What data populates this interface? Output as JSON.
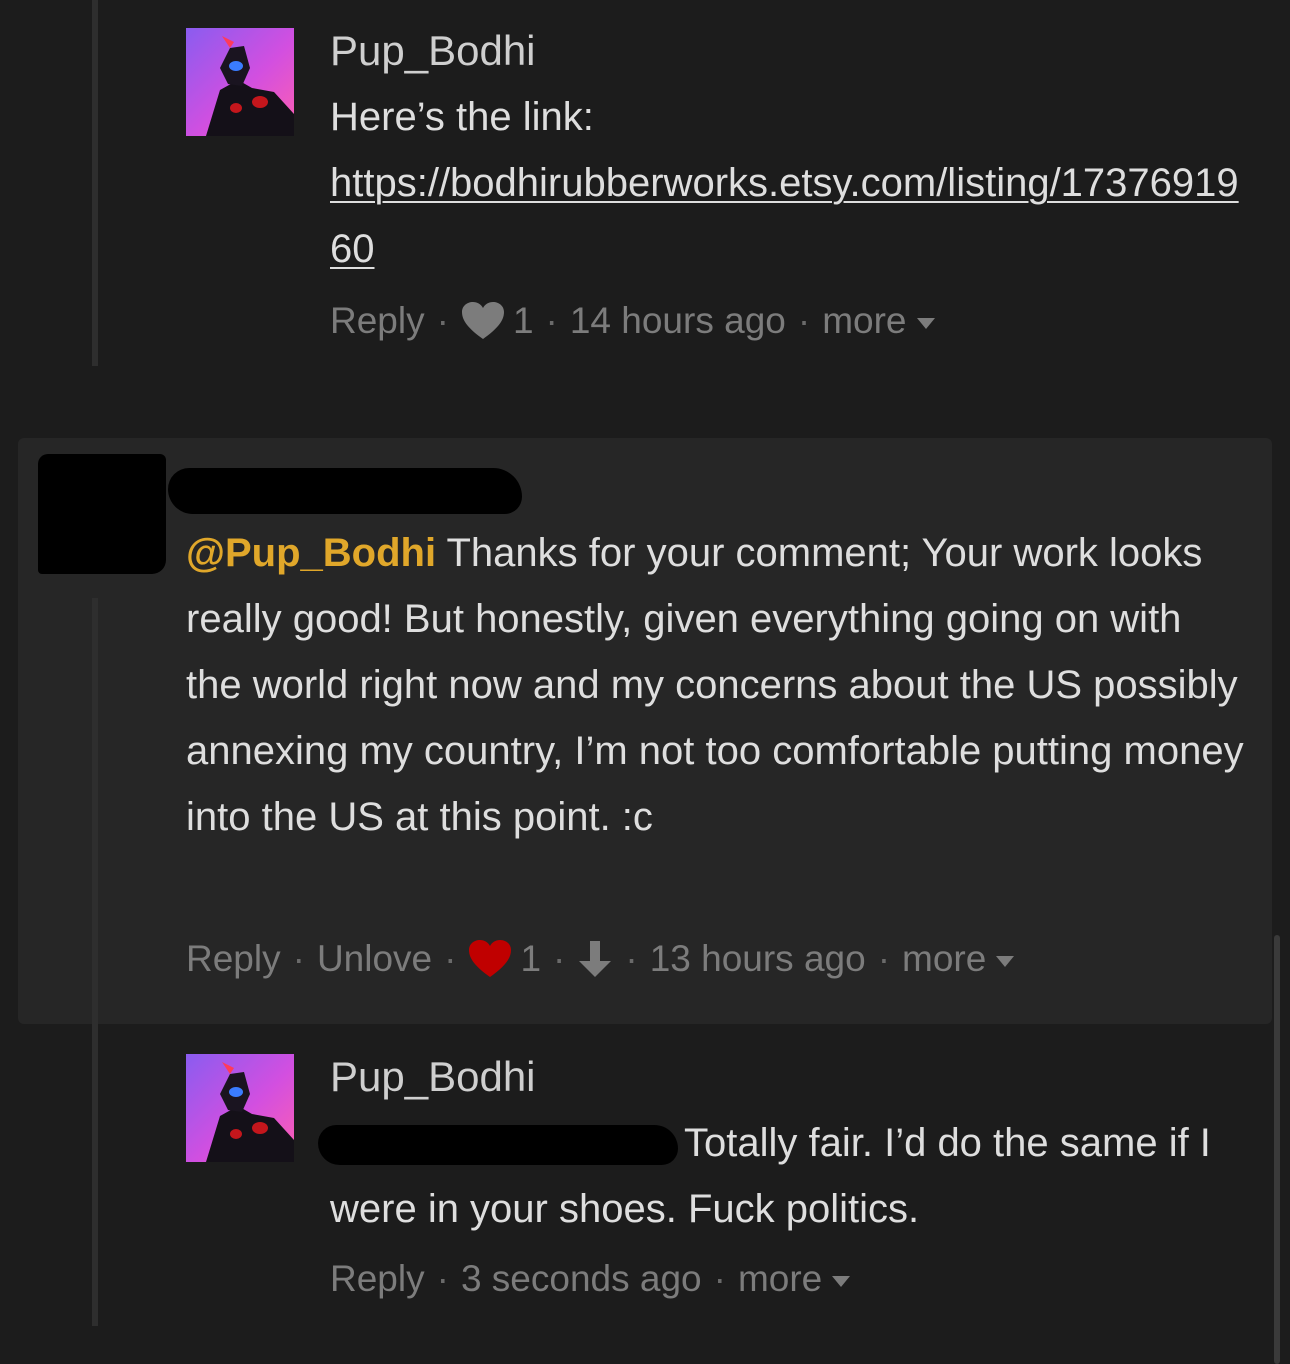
{
  "thread": {
    "comments": [
      {
        "username": "Pup_Bodhi",
        "text": "Here’s the link:",
        "link": "https://bodhirubberworks.etsy.com/listing/1737691960",
        "meta": {
          "reply": "Reply",
          "likes": "1",
          "time": "14 hours ago",
          "more": "more"
        }
      },
      {
        "username": "",
        "mention": "@Pup_Bodhi",
        "text": " Thanks for your comment; Your work looks really good! But honestly, given everything going on with the world right now and my concerns about the US possibly annexing my country, I’m not too comfortable putting money into the US at this point. :c",
        "meta": {
          "reply": "Reply",
          "unlove": "Unlove",
          "likes": "1",
          "time": "13 hours ago",
          "more": "more"
        }
      },
      {
        "username": "Pup_Bodhi",
        "text": "Totally fair. I’d do the same if I were in your shoes. Fuck politics.",
        "meta": {
          "reply": "Reply",
          "time": "3 seconds ago",
          "more": "more"
        }
      }
    ]
  },
  "colors": {
    "background": "#1c1c1c",
    "highlight": "#262626",
    "mention": "#e0a72a",
    "liked_heart": "#c00000",
    "meta_text": "#7c7c7c"
  },
  "icons": [
    "heart-icon",
    "downvote-arrow-icon",
    "caret-down-icon"
  ]
}
